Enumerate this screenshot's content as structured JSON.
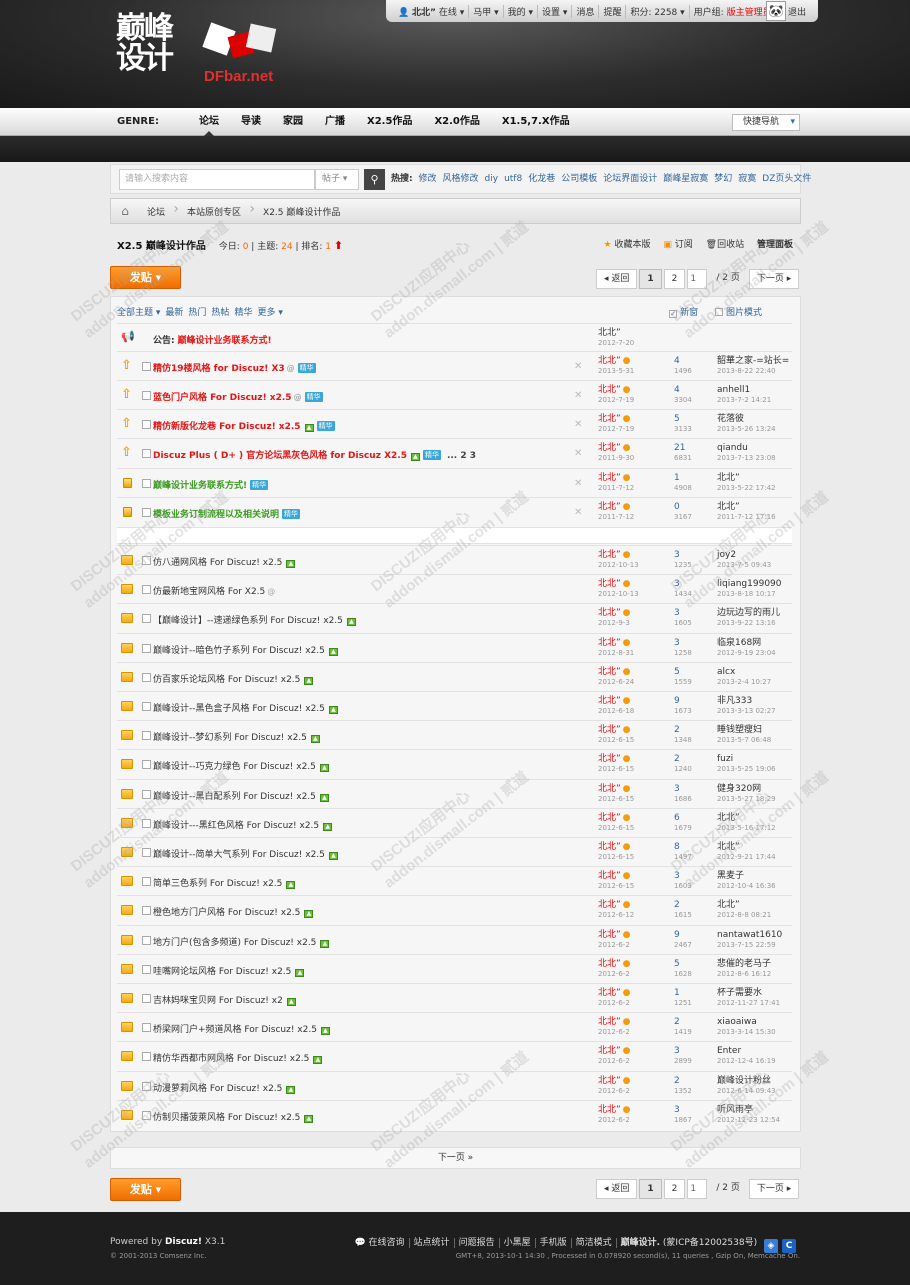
{
  "topbar": {
    "user": "北北”",
    "online": "在线",
    "vest": "马甲",
    "mine": "我的",
    "settings": "设置",
    "messages": "消息",
    "reminders": "提醒",
    "points": "积分: 2258",
    "group": "用户组: ",
    "group_value": "版主管理员",
    "logout": "退出"
  },
  "logo": {
    "cn": "巅峰设计",
    "en": "DFbar.net"
  },
  "nav": {
    "genre": "GENRE:",
    "items": [
      "论坛",
      "导读",
      "家园",
      "广播",
      "X2.5作品",
      "X2.0作品",
      "X1.5,7.X作品"
    ],
    "quicknav": "快捷导航"
  },
  "search": {
    "placeholder": "请输入搜索内容",
    "type": "帖子",
    "hot_label": "热搜:",
    "hot": [
      "修改",
      "风格修改",
      "diy",
      "utf8",
      "化龙巷",
      "公司模板",
      "论坛界面设计",
      "巅峰星寂寞",
      "梦幻",
      "寂寞",
      "DZ页头文件"
    ]
  },
  "breadcrumb": [
    "论坛",
    "本站原创专区",
    "X2.5 巅峰设计作品"
  ],
  "forum": {
    "title": "X2.5 巅峰设计作品",
    "today_label": "今日:",
    "today": "0",
    "topics_label": "主题:",
    "topics": "24",
    "rank_label": "排名:",
    "rank": "1",
    "favorite": "收藏本版",
    "subscribe": "订阅",
    "recycle": "回收站",
    "manage": "管理面板"
  },
  "post_button": "发贴 ▾",
  "pager": {
    "back": "◂ 返回",
    "p1": "1",
    "p2": "2",
    "input": "1",
    "total": "/ 2 页",
    "next": "下一页 ▸"
  },
  "filters": [
    "全部主题 ▾",
    "最新",
    "热门",
    "热帖",
    "精华",
    "更多 ▾"
  ],
  "filters_right": {
    "newwin": "新窗",
    "imgmode": "图片模式"
  },
  "announcement": {
    "label": "公告:",
    "title": "巅峰设计业务联系方式!",
    "author": "北北”",
    "date": "2012-7-20"
  },
  "sticky": [
    {
      "title": "精仿19楼风格 for Discuz! X3",
      "author": "北北”",
      "date": "2013-5-31",
      "replies": "4",
      "views": "1496",
      "last": "韶華之家-=站长=",
      "last_date": "2013-8-22 22:40"
    },
    {
      "title": "蓝色门户风格 For Discuz! x2.5",
      "author": "北北”",
      "date": "2012-7-19",
      "replies": "4",
      "views": "3304",
      "last": "anhell1",
      "last_date": "2013-7-2 14:21"
    },
    {
      "title": "精仿新版化龙巷 For Discuz! x2.5",
      "author": "北北”",
      "date": "2012-7-19",
      "replies": "5",
      "views": "3133",
      "last": "花落彼",
      "last_date": "2013-5-26 13:24"
    },
    {
      "title": "Discuz Plus ( D+ ) 官方论坛黑灰色风格 for Discuz X2.5",
      "pages": "... 2  3",
      "author": "北北”",
      "date": "2011-9-30",
      "replies": "21",
      "views": "6831",
      "last": "qiandu",
      "last_date": "2013-7-13 23:08"
    },
    {
      "title": "巅峰设计业务联系方式!",
      "author": "北北”",
      "date": "2011-7-12",
      "replies": "1",
      "views": "4908",
      "last": "北北”",
      "last_date": "2013-5-22 17:42"
    },
    {
      "title": "模板业务订制流程以及相关说明",
      "author": "北北”",
      "date": "2011-7-12",
      "replies": "0",
      "views": "3167",
      "last": "北北”",
      "last_date": "2011-7-12 17:16"
    }
  ],
  "threads": [
    {
      "title": "仿八通网风格 For Discuz! x2.5",
      "author": "北北”",
      "date": "2012-10-13",
      "replies": "3",
      "views": "1235",
      "last": "joy2",
      "last_date": "2013-7-5 09:43"
    },
    {
      "title": "仿最新地宝网风格 For X2.5",
      "author": "北北”",
      "date": "2012-10-13",
      "replies": "3",
      "views": "1434",
      "last": "liqiang199090",
      "last_date": "2013-8-18 10:17"
    },
    {
      "title": "【巅峰设计】--速递绿色系列 For Discuz! x2.5",
      "author": "北北”",
      "date": "2012-9-3",
      "replies": "3",
      "views": "1605",
      "last": "边玩边写的雨儿",
      "last_date": "2013-9-22 13:16"
    },
    {
      "title": "巅峰设计--暗色竹子系列 For Discuz! x2.5",
      "author": "北北”",
      "date": "2012-8-31",
      "replies": "3",
      "views": "1258",
      "last": "临泉168网",
      "last_date": "2012-9-19 23:04"
    },
    {
      "title": "仿百家乐论坛风格 For Discuz! x2.5",
      "author": "北北”",
      "date": "2012-6-24",
      "replies": "5",
      "views": "1559",
      "last": "alcx",
      "last_date": "2013-2-4 10:27"
    },
    {
      "title": "巅峰设计--黑色盒子风格 For Discuz! x2.5",
      "author": "北北”",
      "date": "2012-6-18",
      "replies": "9",
      "views": "1673",
      "last": "非凡333",
      "last_date": "2013-3-13 02:27"
    },
    {
      "title": "巅峰设计--梦幻系列 For Discuz! x2.5",
      "author": "北北”",
      "date": "2012-6-15",
      "replies": "2",
      "views": "1348",
      "last": "睡钱塑瘦妇",
      "last_date": "2013-5-7 06:48"
    },
    {
      "title": "巅峰设计--巧克力绿色 For Discuz! x2.5",
      "author": "北北”",
      "date": "2012-6-15",
      "replies": "2",
      "views": "1240",
      "last": "fuzi",
      "last_date": "2013-5-25 19:06"
    },
    {
      "title": "巅峰设计--黑白配系列 For Discuz! x2.5",
      "author": "北北”",
      "date": "2012-6-15",
      "replies": "3",
      "views": "1686",
      "last": "健身320网",
      "last_date": "2013-5-27 18:29"
    },
    {
      "title": "巅峰设计---黑红色风格 For Discuz! x2.5",
      "author": "北北”",
      "date": "2012-6-15",
      "replies": "6",
      "views": "1679",
      "last": "北北”",
      "last_date": "2013-5-16 17:12"
    },
    {
      "title": "巅峰设计--简单大气系列 For Discuz! x2.5",
      "author": "北北”",
      "date": "2012-6-15",
      "replies": "8",
      "views": "1497",
      "last": "北北”",
      "last_date": "2012-9-21 17:44"
    },
    {
      "title": "简单三色系列 For Discuz! x2.5",
      "author": "北北”",
      "date": "2012-6-15",
      "replies": "3",
      "views": "1603",
      "last": "黑麦子",
      "last_date": "2012-10-4 16:36"
    },
    {
      "title": "橙色地方门户风格 For Discuz! x2.5",
      "author": "北北”",
      "date": "2012-6-12",
      "replies": "2",
      "views": "1615",
      "last": "北北”",
      "last_date": "2012-8-8 08:21"
    },
    {
      "title": "地方门户(包含多频道) For Discuz! x2.5",
      "author": "北北”",
      "date": "2012-6-2",
      "replies": "9",
      "views": "2467",
      "last": "nantawat1610",
      "last_date": "2013-7-15 22:59"
    },
    {
      "title": "哇嘴网论坛风格 For Discuz! x2.5",
      "author": "北北”",
      "date": "2012-6-2",
      "replies": "5",
      "views": "1628",
      "last": "悲催的老马子",
      "last_date": "2012-8-6 16:12"
    },
    {
      "title": "吉林妈咪宝贝网 For Discuz! x2",
      "author": "北北”",
      "date": "2012-6-2",
      "replies": "1",
      "views": "1251",
      "last": "杯子需要水",
      "last_date": "2012-11-27 17:41"
    },
    {
      "title": "桥梁网门户+频道风格 For Discuz! x2.5",
      "author": "北北”",
      "date": "2012-6-2",
      "replies": "2",
      "views": "1419",
      "last": "xiaoaiwa",
      "last_date": "2013-3-14 15:30"
    },
    {
      "title": "精仿华西都市网风格 For Discuz! x2.5",
      "author": "北北”",
      "date": "2012-6-2",
      "replies": "3",
      "views": "2899",
      "last": "Enter",
      "last_date": "2012-12-4 16:19"
    },
    {
      "title": "动漫萝莉风格 For Discuz! x2.5",
      "author": "北北”",
      "date": "2012-6-2",
      "replies": "2",
      "views": "1352",
      "last": "巅峰设计粉丝",
      "last_date": "2012-6-14 09:43"
    },
    {
      "title": "仿制贝播菠萊风格 For Discuz! x2.5",
      "author": "北北”",
      "date": "2012-6-2",
      "replies": "3",
      "views": "1867",
      "last": "听风雨亭",
      "last_date": "2012-12-23 12:54"
    }
  ],
  "next_page": "下一页 »",
  "footer": {
    "powered": "Powered by ",
    "brand": "Discuz!",
    "ver": " X3.1",
    "copyright": "© 2001-2013 Comsenz Inc.",
    "links": [
      "在线咨询",
      "站点统计",
      "问题报告",
      "小黑屋",
      "手机版",
      "简洁模式",
      "巅峰设计.",
      "(蒙ICP备12002538号)"
    ],
    "gmt": "GMT+8, 2013-10-1 14:30 , Processed in 0.078920 second(s), 11 queries , Gzip On, Memcache On."
  },
  "watermark": {
    "a": "DISCUZ!应用中心",
    "b": "addon.dismall.com",
    "c": "贰道"
  }
}
